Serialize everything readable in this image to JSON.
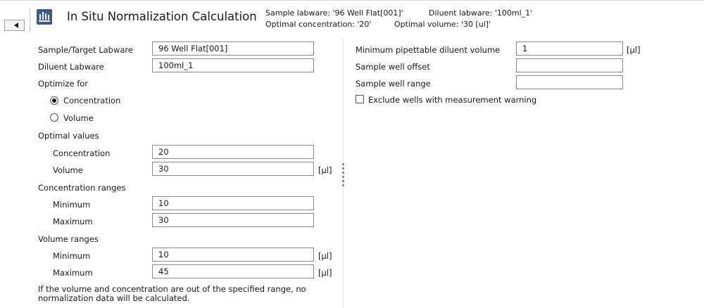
{
  "header": {
    "title": "In Situ Normalization Calculation",
    "sample_labware_info": "Sample labware: '96 Well Flat[001]'",
    "diluent_labware_info": "Diluent labware: '100ml_1'",
    "optimal_concentration_info": "Optimal concentration: '20'",
    "optimal_volume_info": "Optimal volume: '30 [ul]'",
    "icon": "plate-icon",
    "collapse_icon": "triangle-left-icon"
  },
  "left": {
    "sample_target_labware": {
      "label": "Sample/Target Labware",
      "value": "96 Well Flat[001]"
    },
    "diluent_labware": {
      "label": "Diluent Labware",
      "value": "100ml_1"
    },
    "optimize_for": {
      "label": "Optimize for",
      "options": [
        "Concentration",
        "Volume"
      ],
      "selected": "Concentration"
    },
    "optimal_values": {
      "label": "Optimal values",
      "concentration": {
        "label": "Concentration",
        "value": "20"
      },
      "volume": {
        "label": "Volume",
        "value": "30",
        "unit": "[µl]"
      }
    },
    "concentration_ranges": {
      "label": "Concentration ranges",
      "minimum": {
        "label": "Minimum",
        "value": "10"
      },
      "maximum": {
        "label": "Maximum",
        "value": "30"
      }
    },
    "volume_ranges": {
      "label": "Volume ranges",
      "minimum": {
        "label": "Minimum",
        "value": "10",
        "unit": "[µl]"
      },
      "maximum": {
        "label": "Maximum",
        "value": "45",
        "unit": "[µl]"
      }
    },
    "note_line1": "If the volume and concentration are out of the specified range, no",
    "note_line2": "normalization data will be calculated."
  },
  "right": {
    "min_pipettable": {
      "label": "Minimum pipettable diluent volume",
      "value": "1",
      "unit": "[µl]"
    },
    "sample_well_offset": {
      "label": "Sample well offset",
      "value": ""
    },
    "sample_well_range": {
      "label": "Sample well range",
      "value": ""
    },
    "exclude_wells": {
      "label": "Exclude wells with measurement warning",
      "checked": false
    }
  },
  "colors": {
    "icon_bg": "#3d5a80",
    "field_border": "#8a8a8a"
  }
}
